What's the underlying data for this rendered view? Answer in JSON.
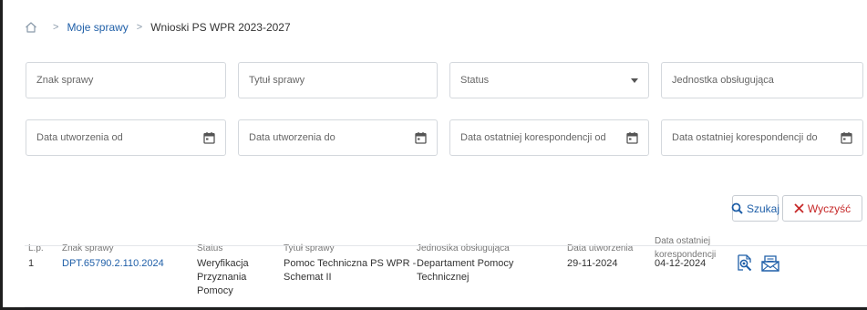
{
  "breadcrumb": {
    "home_icon": "home-icon",
    "items": [
      "Moje sprawy",
      "Wnioski PS WPR 2023-2027"
    ]
  },
  "filters": {
    "znak_sprawy": "Znak sprawy",
    "tytul_sprawy": "Tytuł sprawy",
    "status": "Status",
    "jednostka": "Jednostka obsługująca",
    "data_utw_od": "Data utworzenia od",
    "data_utw_do": "Data utworzenia do",
    "data_kor_od": "Data ostatniej korespondencji od",
    "data_kor_do": "Data ostatniej korespondencji do"
  },
  "buttons": {
    "search": "Szukaj",
    "clear": "Wyczyść"
  },
  "table": {
    "headers": {
      "lp": "L.p.",
      "znak": "Znak sprawy",
      "status": "Status",
      "tytul": "Tytuł sprawy",
      "jednostka": "Jednostka obsługująca",
      "data_utw": "Data utworzenia",
      "data_kor_1": "Data ostatniej",
      "data_kor_2": "korespondencji"
    },
    "rows": [
      {
        "lp": "1",
        "znak": "DPT.65790.2.110.2024",
        "status": [
          "Weryfikacja",
          "Przyznania",
          "Pomocy"
        ],
        "tytul": [
          "Pomoc Techniczna PS WPR -",
          "Schemat II"
        ],
        "jednostka": [
          "Departament Pomocy",
          "Technicznej"
        ],
        "data_utw": "29-11-2024",
        "data_kor": "04-12-2024",
        "actions": [
          "case-preview-icon",
          "correspondence-icon"
        ]
      }
    ]
  },
  "colors": {
    "link": "#1f5fa8",
    "clear": "#c62828",
    "border": "#d4d8dd"
  }
}
